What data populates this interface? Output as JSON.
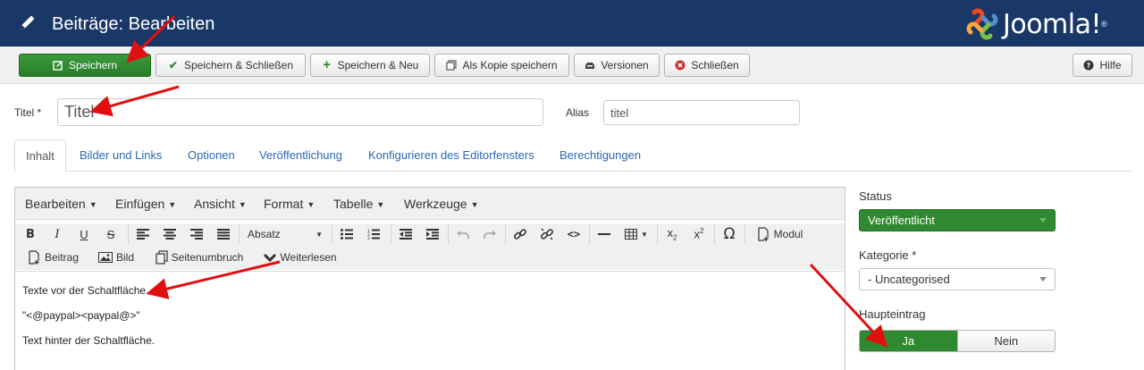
{
  "header": {
    "title": "Beiträge: Bearbeiten",
    "logo_text": "Joomla!",
    "logo_reg": "®"
  },
  "toolbar": {
    "save": "Speichern",
    "save_close": "Speichern & Schließen",
    "save_new": "Speichern & Neu",
    "save_copy": "Als Kopie speichern",
    "versions": "Versionen",
    "close": "Schließen",
    "help": "Hilfe"
  },
  "form": {
    "title_label": "Titel *",
    "title_value": "Titel",
    "alias_label": "Alias",
    "alias_value": "titel"
  },
  "tabs": [
    "Inhalt",
    "Bilder und Links",
    "Optionen",
    "Veröffentlichung",
    "Konfigurieren des Editorfensters",
    "Berechtigungen"
  ],
  "editor": {
    "menus": [
      "Bearbeiten",
      "Einfügen",
      "Ansicht",
      "Format",
      "Tabelle",
      "Werkzeuge"
    ],
    "format_select": "Absatz",
    "modul_button": "Modul",
    "beitrag_button": "Beitrag",
    "bild_button": "Bild",
    "pagebreak_button": "Seitenumbruch",
    "readmore_button": "Weiterlesen",
    "content": [
      "Texte vor der Schaltfläche.",
      "\"<@paypal><paypal@>\"",
      "Text hinter der Schaltfläche."
    ]
  },
  "sidebar": {
    "status_label": "Status",
    "status_value": "Veröffentlicht",
    "category_label": "Kategorie *",
    "category_value": "- Uncategorised",
    "featured_label": "Haupteintrag",
    "featured_yes": "Ja",
    "featured_no": "Nein"
  },
  "colors": {
    "header_bg": "#1a3867",
    "success": "#2f8a2f",
    "link": "#2a69b8",
    "annotation_arrow": "#e01010"
  }
}
